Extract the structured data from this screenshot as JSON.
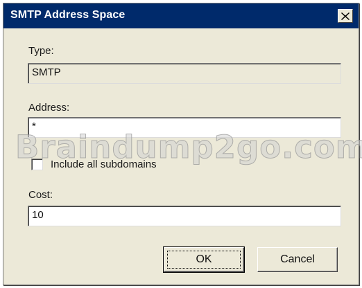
{
  "dialog": {
    "title": "SMTP Address Space",
    "type_label": "Type:",
    "type_value": "SMTP",
    "address_label": "Address:",
    "address_value": "*",
    "include_subdomains_label": "Include all subdomains",
    "include_subdomains_checked": false,
    "cost_label": "Cost:",
    "cost_value": "10",
    "ok_label": "OK",
    "cancel_label": "Cancel"
  },
  "watermark": "Braindump2go.com",
  "colors": {
    "titlebar": "#002a6b",
    "dialog_bg": "#ece9d8"
  }
}
